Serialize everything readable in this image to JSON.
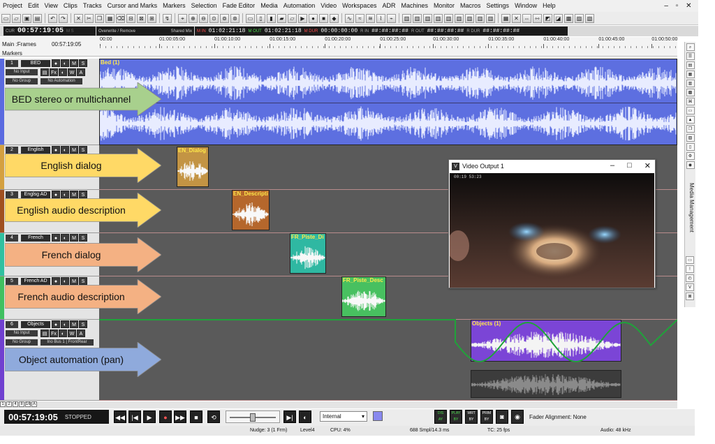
{
  "menu": [
    "Project",
    "Edit",
    "View",
    "Clips",
    "Tracks",
    "Cursor and Marks",
    "Markers",
    "Selection",
    "Fade Editor",
    "Media",
    "Automation",
    "Video",
    "Workspaces",
    "ADR",
    "Machines",
    "Monitor",
    "Macros",
    "Settings",
    "Window",
    "Help"
  ],
  "window_controls": [
    "–",
    "▫",
    "✕"
  ],
  "counters": {
    "cur_label": "CUR",
    "cur_value": "00:57:19:05",
    "rec_mode": "Overwrite / Remove",
    "mix_mode": "Shared Mix",
    "m_in_label": "M IN",
    "m_in_value": "01:02:21:18",
    "m_out_label": "M OUT",
    "m_out_value": "01:02:21:18",
    "m_dur_label": "M DUR",
    "m_dur_value": "00:00:00:00",
    "r_in_label": "R IN",
    "r_in_value": "##:##:##:##",
    "r_out_label": "R OUT",
    "r_out_value": "##:##:##:##",
    "r_dur_label": "R DUR",
    "r_dur_value": "##:##:##:##"
  },
  "ruler": {
    "main_label": "Main :Frames",
    "main_value": "00:57:19:05",
    "markers_label": "Markers",
    "ticks": [
      "00:00",
      "01:00:05:00",
      "01:00:10:00",
      "01:00:15:00",
      "01:00:20:00",
      "01:00:25:00",
      "01:00:30:00",
      "01:00:35:00",
      "01:00:40:00",
      "01:00:45:00",
      "01:00:50:00"
    ]
  },
  "tracks": [
    {
      "num": "1",
      "name": "BED",
      "input": "No Input",
      "group": "No Group",
      "auto": "No Automation",
      "color": "#5a6ae0"
    },
    {
      "num": "2",
      "name": "English",
      "color": "#d4a040"
    },
    {
      "num": "3",
      "name": "Englsg AD",
      "color": "#a05020"
    },
    {
      "num": "4",
      "name": "French",
      "color": "#30c0a0"
    },
    {
      "num": "5",
      "name": "French AD",
      "color": "#40c060"
    },
    {
      "num": "6",
      "name": "Objects",
      "input": "No Input",
      "group": "No Group",
      "bus": "Ino Bus 1 | FrontRear",
      "color": "#7040d0"
    }
  ],
  "track_buttons": [
    "●",
    "◐",
    "M",
    "S"
  ],
  "track_buttons_row2": [
    "▤",
    "Fx",
    "◐",
    "W",
    "A"
  ],
  "clips": [
    {
      "title": "Bed (1)"
    },
    {
      "title": "EN_Dialog"
    },
    {
      "title": "EN_Descripti"
    },
    {
      "title": "FR_Piste_Di"
    },
    {
      "title": "FR_Piste_Desc"
    },
    {
      "title": "Objects (1)"
    }
  ],
  "annotations": [
    {
      "text": "BED stereo or multichannel",
      "color": "#a8d08d"
    },
    {
      "text": "English dialog",
      "color": "#ffd966"
    },
    {
      "text": "English audio description",
      "color": "#ffd966"
    },
    {
      "text": "French dialog",
      "color": "#f4b183"
    },
    {
      "text": "French audio description",
      "color": "#f4b183"
    },
    {
      "text": "Object automation (pan)",
      "color": "#8faadc"
    }
  ],
  "video": {
    "title": "Video Output 1",
    "timecode": "00:19 53:23"
  },
  "sidebar": {
    "label": "Media Management"
  },
  "zoom_buttons": [
    "1",
    "2",
    "4",
    "8",
    "16",
    "A"
  ],
  "transport": {
    "time": "00:57:19:05",
    "state": "STOPPED",
    "sync": "Internal",
    "fader_alignment": "Fader Alignment: None",
    "mode_buttons": [
      {
        "l1": "DIS",
        "l2": "AY"
      },
      {
        "l1": "PLAY",
        "l2": "BY"
      },
      {
        "l1": "WRT",
        "l2": "BY"
      },
      {
        "l1": "PRIM",
        "l2": "BY"
      }
    ]
  },
  "status": {
    "nudge": "Nudge: 3 (1 Frm)",
    "level": "Level4",
    "cpu": "CPU: 4%",
    "buffer": "688 Smpl/14.3 ms",
    "tc": "TC: 25 fps",
    "audio": "Audio: 48 kHz"
  }
}
